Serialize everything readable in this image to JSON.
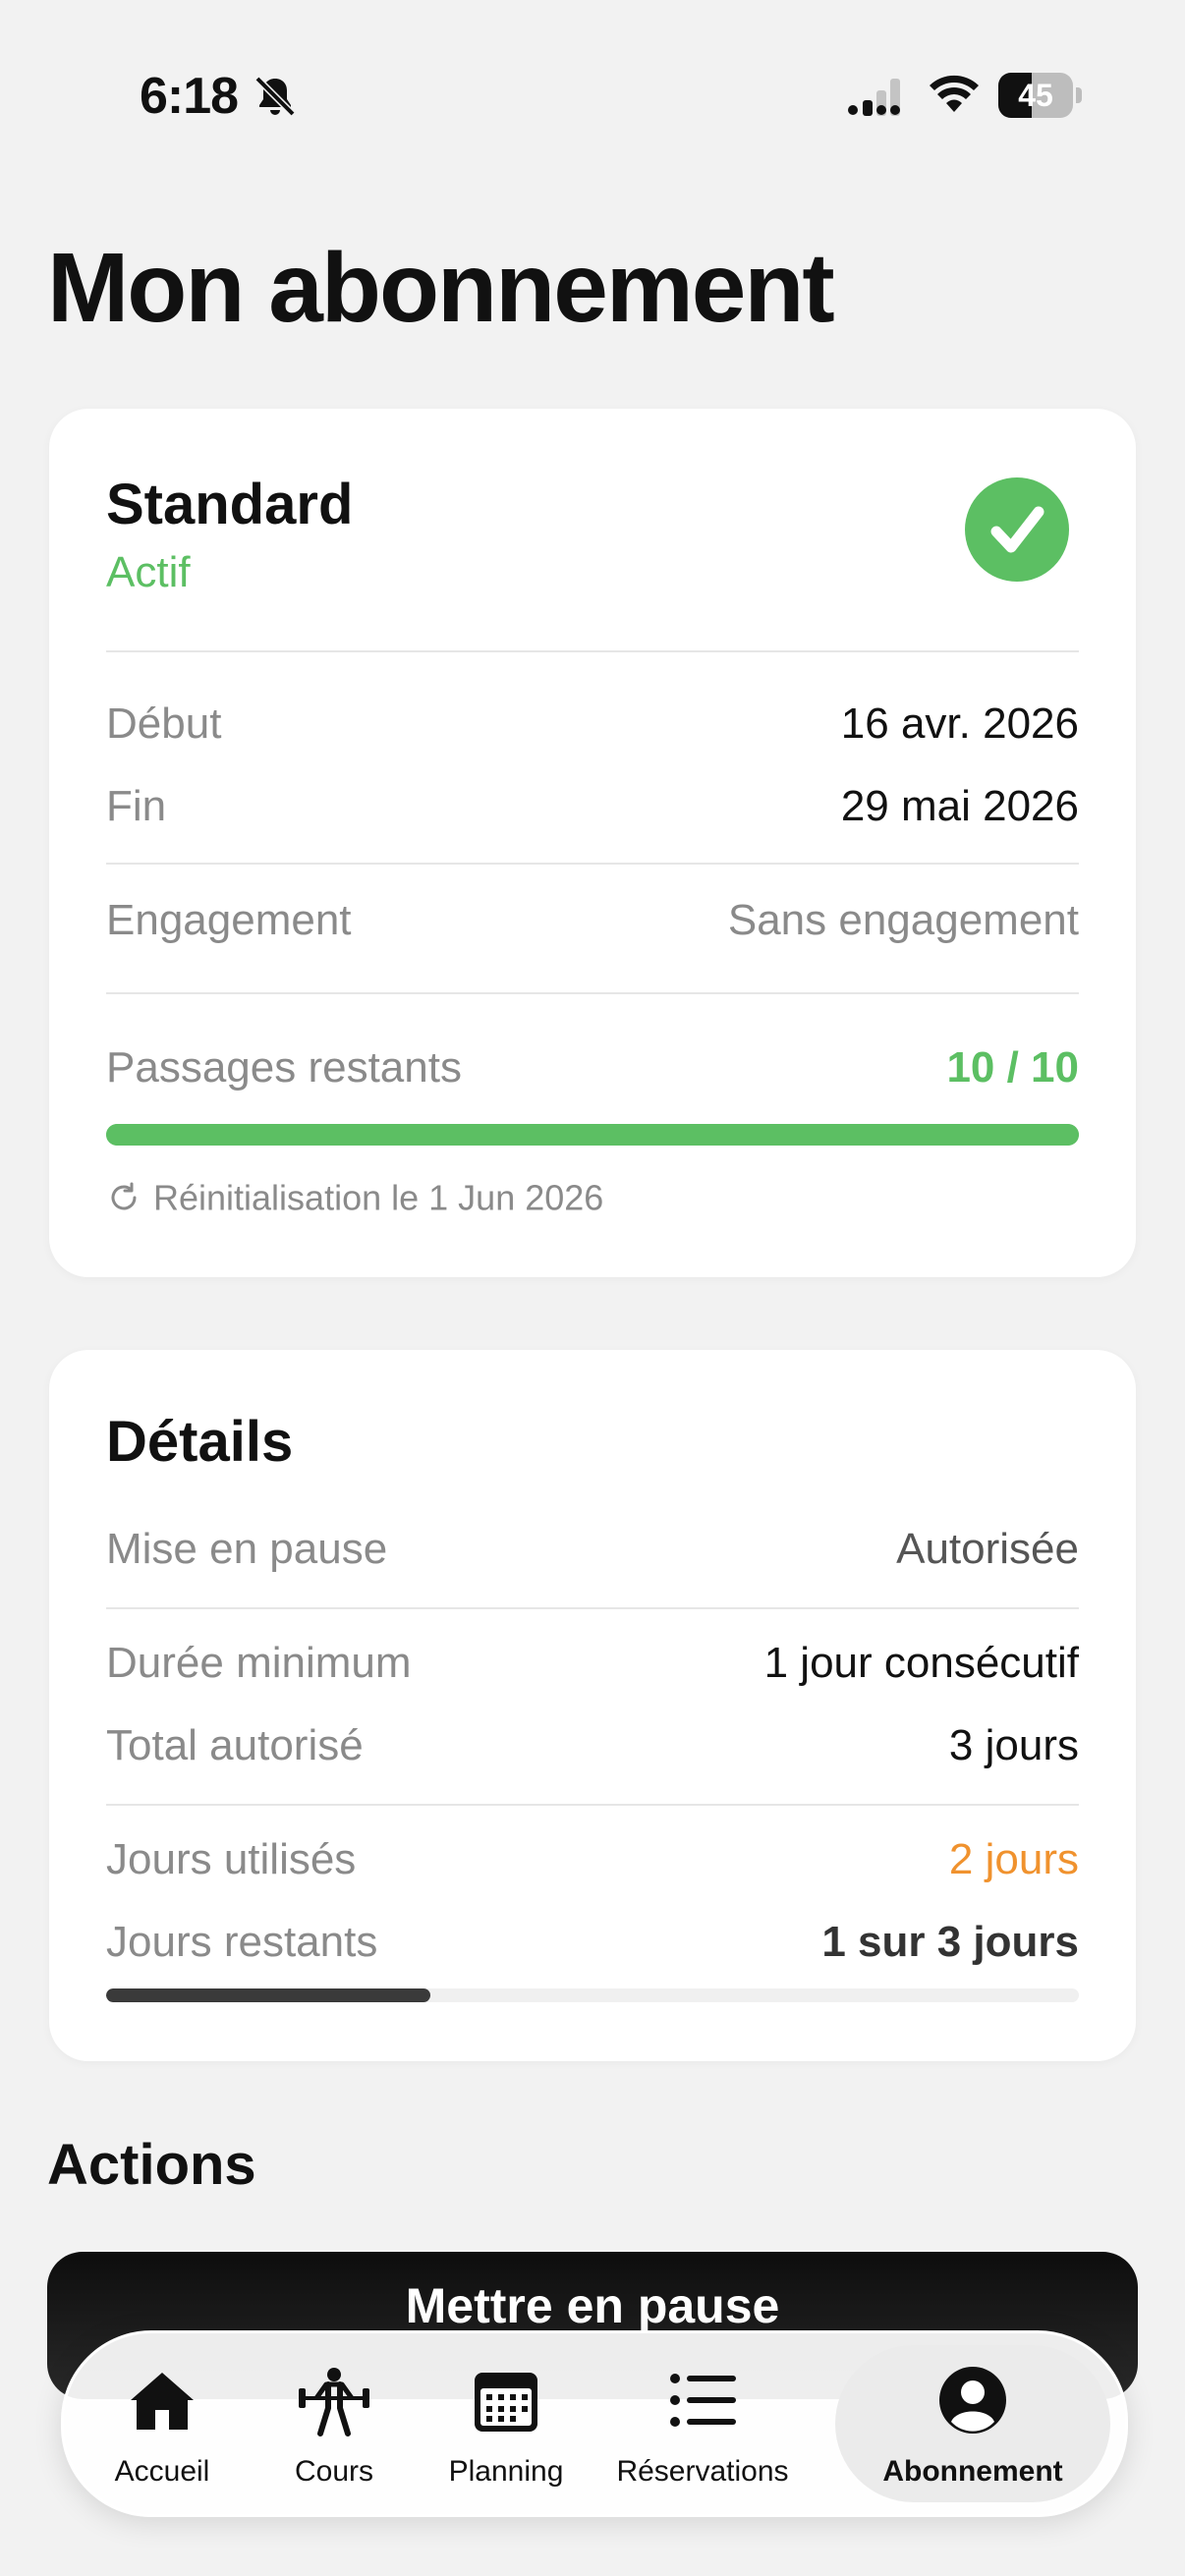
{
  "status_bar": {
    "time": "6:18",
    "battery": "45",
    "battery_level": 0.45
  },
  "title": "Mon abonnement",
  "subscription": {
    "plan": "Standard",
    "status": "Actif",
    "start_label": "Début",
    "start_value": "16 avr. 2026",
    "end_label": "Fin",
    "end_value": "29 mai 2026",
    "commitment_label": "Engagement",
    "commitment_value": "Sans engagement",
    "passes_label": "Passages restants",
    "passes_value": "10 / 10",
    "passes_ratio": 1.0,
    "reset_text": "Réinitialisation le 1 Jun 2026"
  },
  "details": {
    "title": "Détails",
    "pause_label": "Mise en pause",
    "pause_value": "Autorisée",
    "min_duration_label": "Durée minimum",
    "min_duration_value": "1 jour consécutif",
    "total_label": "Total autorisé",
    "total_value": "3 jours",
    "used_label": "Jours utilisés",
    "used_value": "2 jours",
    "remaining_label": "Jours restants",
    "remaining_value": "1 sur 3 jours",
    "remaining_ratio": 0.3333
  },
  "actions": {
    "title": "Actions",
    "pause_button": "Mettre en pause"
  },
  "tabs": [
    {
      "label": "Accueil",
      "icon": "home-icon"
    },
    {
      "label": "Cours",
      "icon": "weightlifter-icon"
    },
    {
      "label": "Planning",
      "icon": "calendar-icon"
    },
    {
      "label": "Réservations",
      "icon": "list-icon"
    },
    {
      "label": "Abonnement",
      "icon": "person-circle-icon",
      "active": true
    }
  ],
  "colors": {
    "green": "#5cbf63",
    "orange": "#f0922e",
    "dark_bar": "#3a3a3a"
  }
}
